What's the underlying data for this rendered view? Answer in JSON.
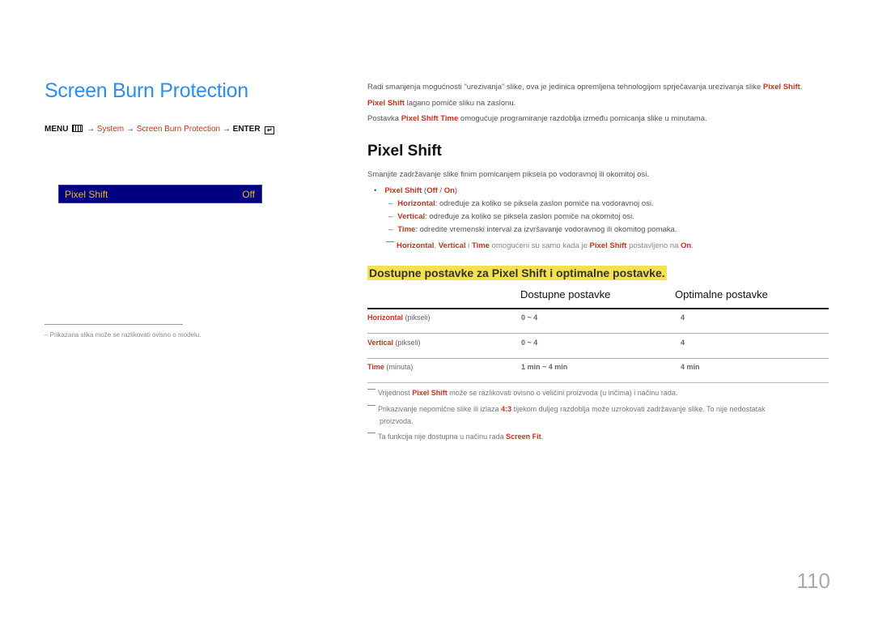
{
  "left": {
    "title": "Screen Burn Protection",
    "path": {
      "menu": "MENU",
      "arrow": "→",
      "system": "System",
      "screen_burn": "Screen Burn Protection",
      "enter": "ENTER"
    },
    "osd": {
      "label": "Pixel Shift",
      "value": "Off"
    },
    "footnote": "Prikazana slika može se razlikovati ovisno o modelu."
  },
  "intro": {
    "line1_pre": "Radi smanjenja mogućnosti \"urezivanja\" slike, ova je jedinica opremljena tehnologijom sprječavanja urezivanja slike ",
    "line1_red": "Pixel Shift",
    "line1_post": ".",
    "line2_red": "Pixel Shift",
    "line2_post": " lagano pomiče sliku na zaslonu.",
    "line3_pre": "Postavka ",
    "line3_red": "Pixel Shift Time",
    "line3_post": " omogućuje programiranje razdoblja između pomicanja slike u minutama."
  },
  "section": {
    "heading": "Pixel Shift",
    "desc": "Smanjite zadržavanje slike finim pomicanjem piksela po vodoravnoj ili okomitoj osi.",
    "bullet": {
      "name": "Pixel Shift",
      "off": "Off",
      "on": "On"
    },
    "items": [
      {
        "term": "Horizontal",
        "text": ": određuje za koliko se piksela zaslon pomiče na vodoravnoj osi."
      },
      {
        "term": "Vertical",
        "text": ": određuje za koliko se piksela zaslon pomiče na okomitoj osi."
      },
      {
        "term": "Time",
        "text": ": odredite vremenski interval za izvršavanje vodoravnog ili okomitog pomaka."
      }
    ],
    "note": {
      "horizontal": "Horizontal",
      "vertical": "Vertical",
      "i": " i ",
      "time": "Time",
      "mid": " omogućeni su samo kada je ",
      "pixel_shift": "Pixel Shift",
      "post": " postavljeno na ",
      "on": "On"
    }
  },
  "table": {
    "heading": "Dostupne postavke za Pixel Shift i optimalne postavke.",
    "columns": [
      "",
      "Dostupne postavke",
      "Optimalne postavke"
    ],
    "rows": [
      {
        "name": "Horizontal",
        "unit": " (pikseli)",
        "available": "0 ~ 4",
        "optimal": "4"
      },
      {
        "name": "Vertical",
        "unit": " (pikseli)",
        "available": "0 ~ 4",
        "optimal": "4"
      },
      {
        "name": "Time",
        "unit": " (minuta)",
        "available": "1 min ~ 4 min",
        "optimal": "4 min"
      }
    ]
  },
  "notes": {
    "n1_pre": "Vrijednost ",
    "n1_red": "Pixel Shift",
    "n1_post": " može se razlikovati ovisno o veličini proizvoda (u inčima) i načinu rada.",
    "n2_pre": "Prikazivanje nepomične slike ili izlaza ",
    "n2_red": "4:3",
    "n2_post": " tijekom duljeg razdoblja može uzrokovati zadržavanje slike. To nije nedostatak",
    "n2_cont": "proizvoda.",
    "n3_pre": "Ta funkcija nije dostupna u načinu rada ",
    "n3_red": "Screen Fit",
    "n3_post": "."
  },
  "page_number": "110"
}
